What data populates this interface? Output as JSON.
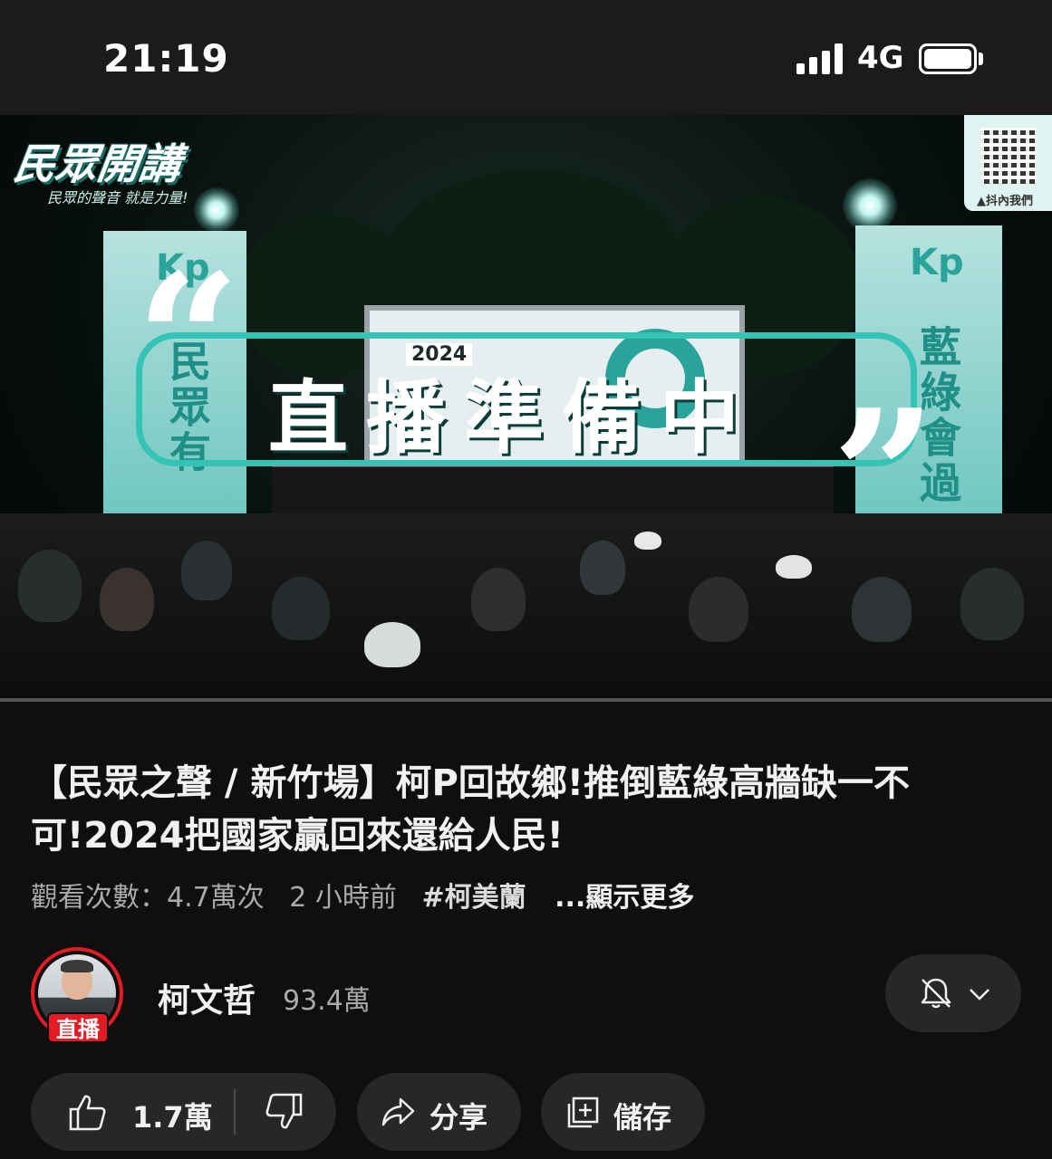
{
  "status_bar": {
    "time": "21:19",
    "network": "4G",
    "signal_icon": "signal-bars-icon",
    "battery_icon": "battery-icon"
  },
  "video": {
    "overlay_text": "直播準備中",
    "channel_logo": "民眾開講",
    "channel_logo_sub": "民眾的聲音 就是力量!",
    "qr_label": "▲抖內我們",
    "banner_left_text": "民眾有",
    "banner_right_text": "藍綠會過",
    "banner_brand": "Kp",
    "stage_year": "2024"
  },
  "title": "【民眾之聲 / 新竹場】柯P回故鄉!推倒藍綠高牆缺一不可!2024把國家贏回來還給人民!",
  "meta": {
    "views": "觀看次數：4.7萬次",
    "time_ago": "2 小時前",
    "hashtag": "#柯美蘭",
    "more": "...顯示更多"
  },
  "channel": {
    "name": "柯文哲",
    "subscribers": "93.4萬",
    "live_badge": "直播",
    "bell_icon": "bell-off-icon",
    "chevron_icon": "chevron-down-icon"
  },
  "actions": {
    "like_count": "1.7萬",
    "share_label": "分享",
    "save_label": "儲存"
  },
  "colors": {
    "background": "#0f0f0f",
    "pill": "#272727",
    "live_red": "#e11c24",
    "overlay_teal": "#35c3b5"
  }
}
